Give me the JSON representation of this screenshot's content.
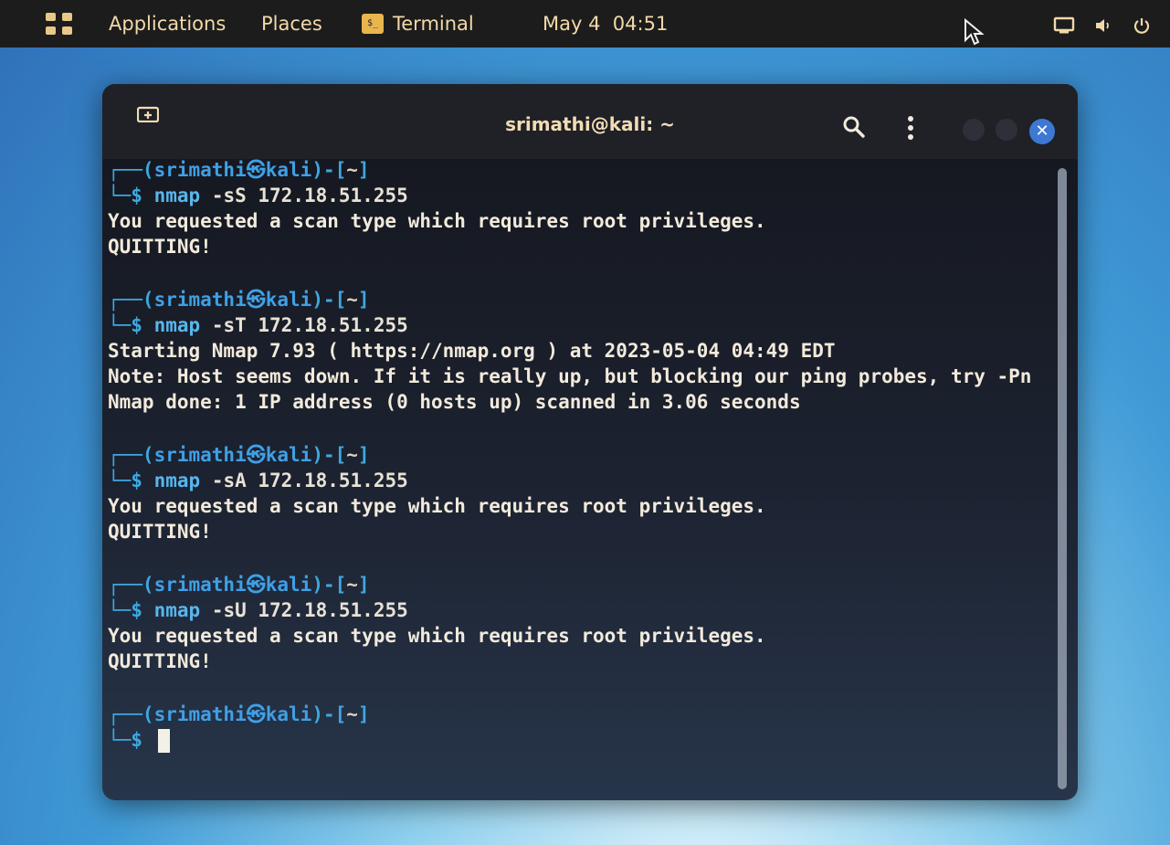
{
  "topbar": {
    "applications_label": "Applications",
    "places_label": "Places",
    "terminal_label": "Terminal",
    "terminal_icon_glyph": "$_",
    "datetime": "May 4  04:51"
  },
  "window": {
    "title": "srimathi@kali: ~",
    "close_glyph": "✕"
  },
  "terminal": {
    "prompt_user": "srimathi",
    "prompt_host": "kali",
    "prompt_dir": "~",
    "blocks": [
      {
        "command": "nmap -sS 172.18.51.255",
        "output": [
          "You requested a scan type which requires root privileges.",
          "QUITTING!"
        ]
      },
      {
        "command": "nmap -sT 172.18.51.255",
        "output": [
          "Starting Nmap 7.93 ( https://nmap.org ) at 2023-05-04 04:49 EDT",
          "Note: Host seems down. If it is really up, but blocking our ping probes, try -Pn",
          "Nmap done: 1 IP address (0 hosts up) scanned in 3.06 seconds"
        ]
      },
      {
        "command": "nmap -sA 172.18.51.255",
        "output": [
          "You requested a scan type which requires root privileges.",
          "QUITTING!"
        ]
      },
      {
        "command": "nmap -sU 172.18.51.255",
        "output": [
          "You requested a scan type which requires root privileges.",
          "QUITTING!"
        ]
      }
    ]
  },
  "colors": {
    "panel_bg": "#1c1c1c",
    "panel_text": "#f3d9a9",
    "prompt_blue": "#3fa0e6",
    "close_button": "#3d78d4"
  }
}
